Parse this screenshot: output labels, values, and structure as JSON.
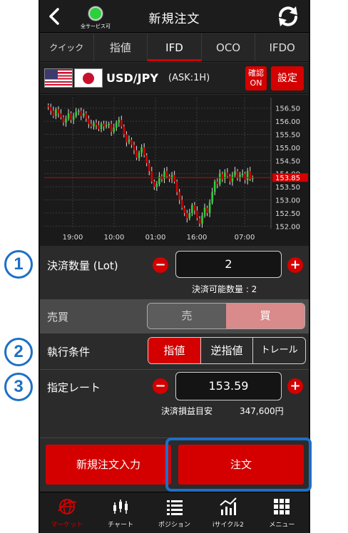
{
  "header": {
    "status_label": "全サービス可",
    "title": "新規注文"
  },
  "tabs": [
    {
      "label": "クイック"
    },
    {
      "label": "指値"
    },
    {
      "label": "IFD"
    },
    {
      "label": "OCO"
    },
    {
      "label": "IFDO"
    }
  ],
  "active_tab": "IFD",
  "currency": {
    "pair": "USD/JPY",
    "ask": "(ASK:1H)",
    "confirm_line1": "確認",
    "confirm_line2": "ON",
    "settings_label": "設定"
  },
  "chart_data": {
    "type": "candlestick",
    "y_ticks": [
      "156.50",
      "156.00",
      "155.50",
      "155.00",
      "154.50",
      "154.00",
      "153.50",
      "153.00",
      "152.50",
      "152.00"
    ],
    "ylim": [
      151.9,
      156.9
    ],
    "x_ticks": [
      "19:00",
      "10:00",
      "01:00",
      "16:00",
      "07:00"
    ],
    "current_price": "153.85",
    "closes": [
      156.55,
      156.4,
      156.2,
      156.45,
      156.3,
      156.15,
      155.95,
      156.1,
      156.3,
      156.05,
      156.2,
      156.35,
      156.4,
      156.2,
      156.3,
      156.1,
      155.9,
      155.8,
      155.95,
      155.85,
      155.7,
      155.9,
      155.8,
      155.85,
      155.9,
      155.6,
      155.75,
      155.95,
      156.05,
      155.8,
      155.5,
      155.2,
      155.3,
      155.1,
      154.9,
      154.6,
      154.8,
      155.0,
      154.7,
      154.4,
      154.1,
      153.7,
      153.5,
      153.6,
      153.9,
      153.8,
      154.1,
      153.9,
      153.8,
      153.95,
      153.7,
      153.3,
      153.0,
      152.7,
      152.5,
      152.3,
      152.5,
      152.8,
      152.6,
      152.3,
      152.1,
      152.4,
      152.7,
      152.5,
      152.9,
      153.3,
      153.7,
      153.6,
      154.0,
      153.8,
      154.05,
      153.9,
      153.7,
      153.95,
      154.1,
      153.85,
      153.95,
      154.0,
      153.75,
      154.1,
      153.8,
      153.85
    ]
  },
  "quantity": {
    "label": "決済数量 (Lot)",
    "value": "2",
    "available": "決済可能数量 : 2"
  },
  "side": {
    "label": "売買",
    "sell": "売",
    "buy": "買",
    "selected": "buy"
  },
  "condition": {
    "label": "執行条件",
    "options": [
      "指値",
      "逆指値",
      "トレール"
    ],
    "selected": "指値"
  },
  "rate": {
    "label": "指定レート",
    "value": "153.59",
    "pl_label": "決済損益目安",
    "pl_value": "347,600円"
  },
  "annotations": [
    "1",
    "2",
    "3"
  ],
  "buttons": {
    "new_order": "新規注文入力",
    "order": "注文"
  },
  "nav": [
    {
      "label": "マーケット",
      "icon": "globe-icon"
    },
    {
      "label": "チャート",
      "icon": "candlestick-icon"
    },
    {
      "label": "ポジション",
      "icon": "list-icon"
    },
    {
      "label": "iサイクル2",
      "icon": "line-chart-icon"
    },
    {
      "label": "メニュー",
      "icon": "grid-icon"
    }
  ],
  "colors": {
    "accent": "#d40000",
    "highlight": "#1e6fc6",
    "status_ok": "#2bd13a",
    "up_candle": "#2bd13a",
    "down_candle": "#d40000"
  }
}
